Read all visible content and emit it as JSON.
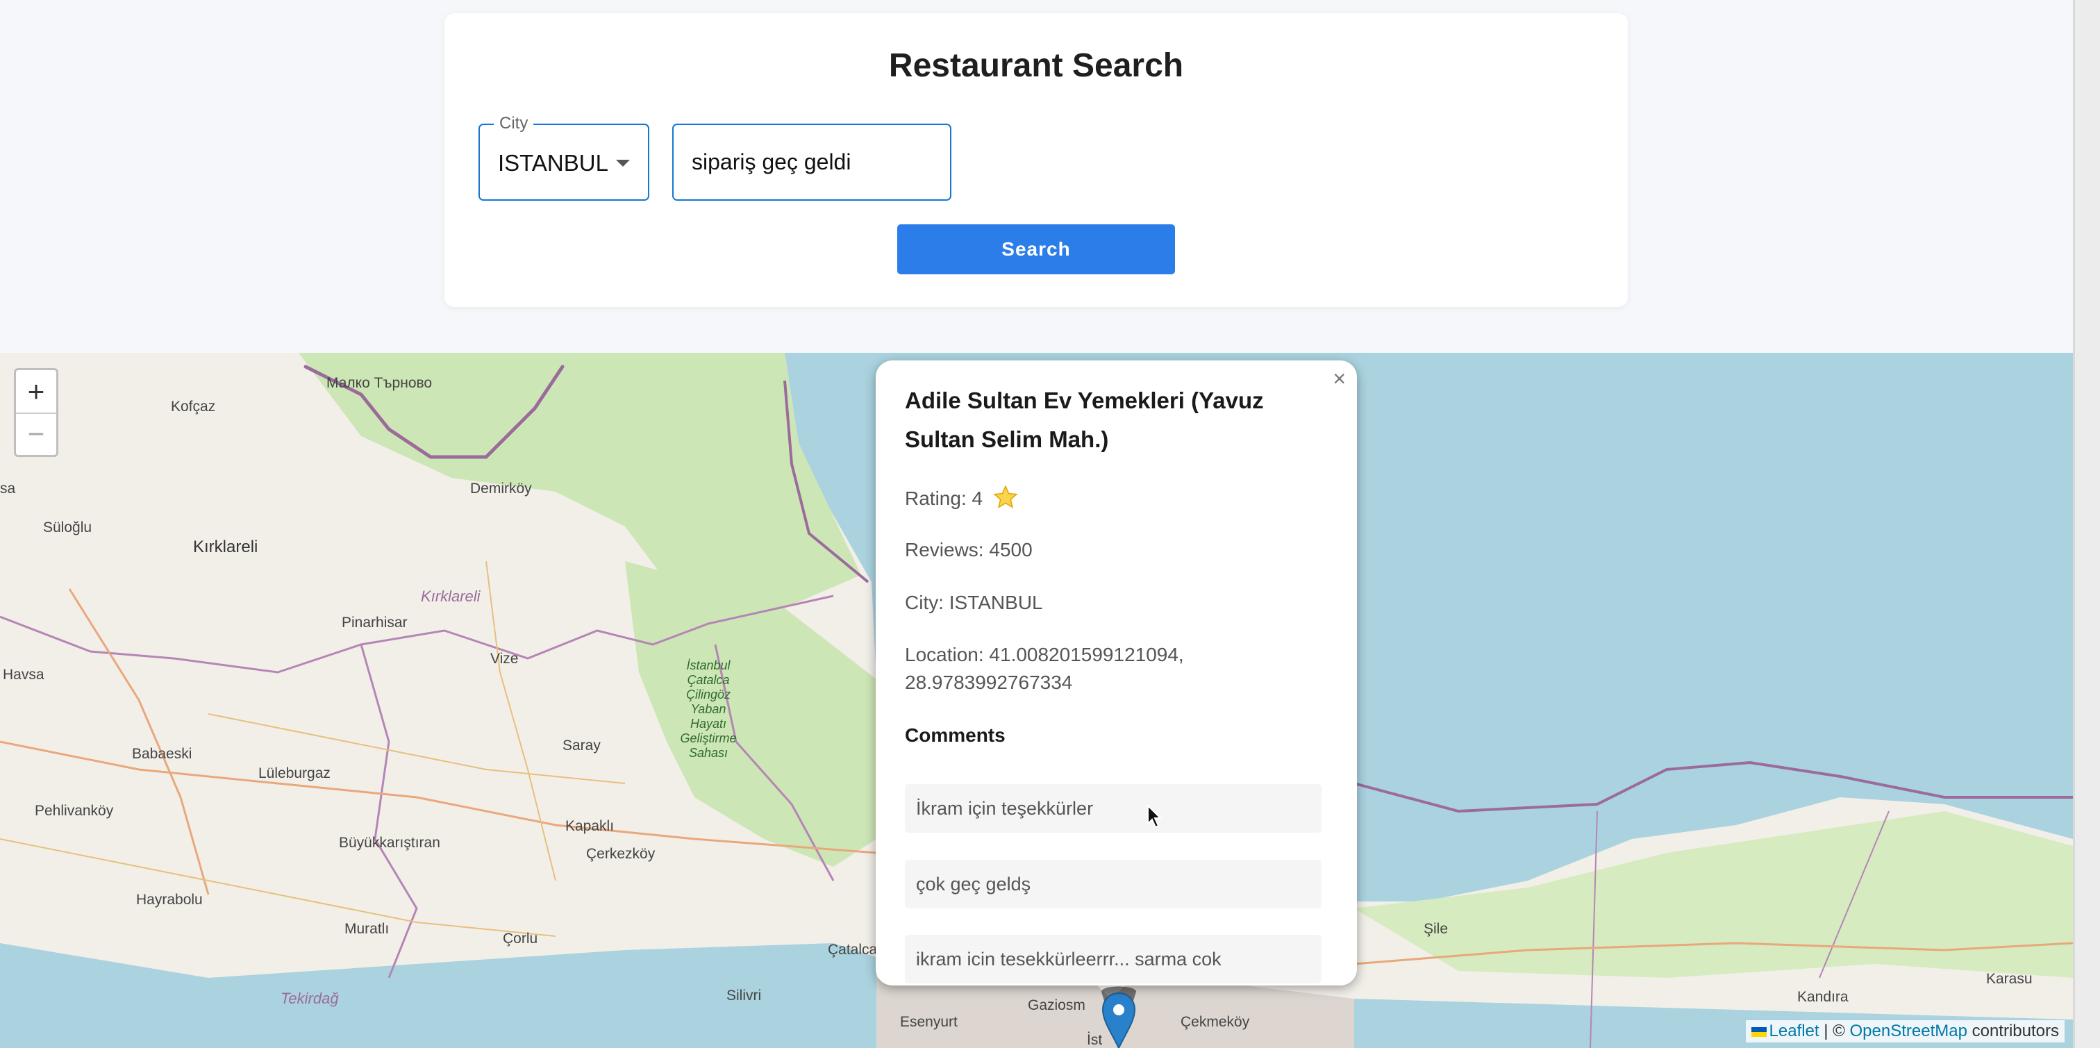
{
  "search": {
    "title": "Restaurant Search",
    "city_label": "City",
    "city_value": "ISTANBUL",
    "query_value": "sipariş geç geldi",
    "button_label": "Search"
  },
  "map": {
    "zoom_in": "+",
    "zoom_out": "−",
    "labels": {
      "kofcaz": "Kofçaz",
      "malko": "Малко Търново",
      "demirkoy": "Demirköy",
      "suloglu": "Süloğlu",
      "kirklareli_city": "Kırklareli",
      "kirklareli_province": "Kırklareli",
      "pinarhisar": "Pinarhisar",
      "havsa": "Havsa",
      "vize": "Vize",
      "istanbul_park": "İstanbul Çatalca Çilingöz Yaban Hayatı Geliştirme Sahası",
      "babaeski": "Babaeski",
      "luleburgaz": "Lüleburgaz",
      "saray": "Saray",
      "pehlivankoy": "Pehlivanköy",
      "buyukkaristiran": "Büyükkarıştıran",
      "kapakli": "Kapaklı",
      "cerkezkoy": "Çerkezköy",
      "hayrabolu": "Hayrabolu",
      "muratli": "Muratlı",
      "corlu": "Çorlu",
      "catalca": "Çatalca",
      "tekirdag": "Tekirdağ",
      "silivri": "Silivri",
      "esenyurt": "Esenyurt",
      "gaziosmanpasa": "Gaziosm",
      "cekmekoy": "Çekmeköy",
      "sile": "Şile",
      "kandira": "Kandıra",
      "karasu": "Karasu",
      "sa": "sa",
      "ist": "İst"
    },
    "attribution": {
      "leaflet": "Leaflet",
      "separator": " | © ",
      "osm": "OpenStreetMap",
      "contributors": " contributors"
    },
    "colors": {
      "water": "#aad3df",
      "land": "#f2efe9",
      "forest": "#cde6b6",
      "border": "#9b6b9b",
      "marker": "#2a81cb"
    }
  },
  "popup": {
    "close": "×",
    "title": "Adile Sultan Ev Yemekleri (Yavuz Sultan Selim Mah.)",
    "rating_label": "Rating: 4",
    "rating_icon": "star-icon",
    "reviews": "Reviews: 4500",
    "city": "City: ISTANBUL",
    "location": "Location: 41.008201599121094, 28.9783992767334",
    "comments_heading": "Comments",
    "comments": [
      "İkram için teşekkürler",
      "çok geç geldş",
      "ikram icin tesekkürleerrr... sarma cok"
    ]
  }
}
